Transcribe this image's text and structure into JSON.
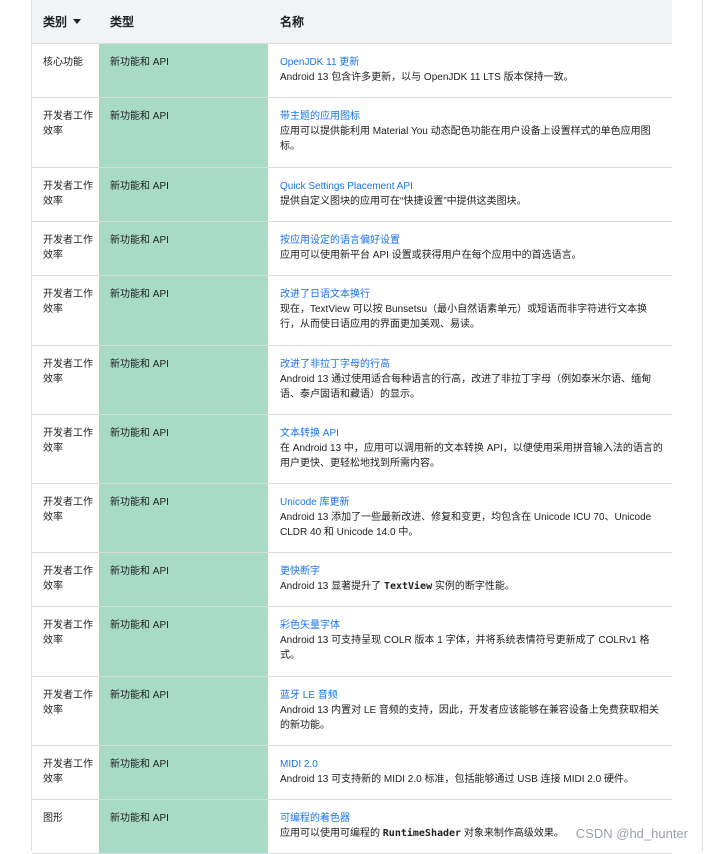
{
  "table": {
    "headers": {
      "category": "类别",
      "type": "类型",
      "name": "名称"
    },
    "rows": [
      {
        "category": "核心功能",
        "type": "新功能和 API",
        "title": "OpenJDK 11 更新",
        "desc": "Android 13 包含许多更新，以与 OpenJDK 11 LTS 版本保持一致。"
      },
      {
        "category": "开发者工作效率",
        "type": "新功能和 API",
        "title": "带主题的应用图标",
        "desc": "应用可以提供能利用 Material You 动态配色功能在用户设备上设置样式的单色应用图标。"
      },
      {
        "category": "开发者工作效率",
        "type": "新功能和 API",
        "title": "Quick Settings Placement API",
        "desc": "提供自定义图块的应用可在“快捷设置”中提供这类图块。"
      },
      {
        "category": "开发者工作效率",
        "type": "新功能和 API",
        "title": "按应用设定的语言偏好设置",
        "desc": "应用可以使用新平台 API 设置或获得用户在每个应用中的首选语言。"
      },
      {
        "category": "开发者工作效率",
        "type": "新功能和 API",
        "title": "改进了日语文本换行",
        "desc": "现在，TextView 可以按 Bunsetsu（最小自然语素单元）或短语而非字符进行文本换行，从而使日语应用的界面更加美观、易读。"
      },
      {
        "category": "开发者工作效率",
        "type": "新功能和 API",
        "title": "改进了非拉丁字母的行高",
        "desc": "Android 13 通过使用适合每种语言的行高，改进了非拉丁字母（例如泰米尔语、缅甸语、泰卢固语和藏语）的显示。"
      },
      {
        "category": "开发者工作效率",
        "type": "新功能和 API",
        "title": "文本转换 API",
        "desc": "在 Android 13 中，应用可以调用新的文本转换 API，以便使用采用拼音输入法的语言的用户更快、更轻松地找到所需内容。"
      },
      {
        "category": "开发者工作效率",
        "type": "新功能和 API",
        "title": "Unicode 库更新",
        "desc": "Android 13 添加了一些最新改进、修复和变更，均包含在 Unicode ICU 70、Unicode CLDR 40 和 Unicode 14.0 中。"
      },
      {
        "category": "开发者工作效率",
        "type": "新功能和 API",
        "title": "更快断字",
        "desc_pre": "Android 13 显著提升了 ",
        "desc_code": "TextView",
        "desc_post": " 实例的断字性能。"
      },
      {
        "category": "开发者工作效率",
        "type": "新功能和 API",
        "title": "彩色矢量字体",
        "desc": "Android 13 可支持呈现 COLR 版本 1 字体，并将系统表情符号更新成了 COLRv1 格式。"
      },
      {
        "category": "开发者工作效率",
        "type": "新功能和 API",
        "title": "蓝牙 LE 音频",
        "desc": "Android 13 内置对 LE 音频的支持，因此，开发者应该能够在兼容设备上免费获取相关的新功能。"
      },
      {
        "category": "开发者工作效率",
        "type": "新功能和 API",
        "title": "MIDI 2.0",
        "desc": "Android 13 可支持新的 MIDI 2.0 标准，包括能够通过 USB 连接 MIDI 2.0 硬件。"
      },
      {
        "category": "图形",
        "type": "新功能和 API",
        "title": "可编程的着色器",
        "desc_pre": "应用可以使用可编程的 ",
        "desc_code": "RuntimeShader",
        "desc_post": " 对象来制作高级效果。"
      }
    ]
  },
  "watermark": "CSDN @hd_hunter",
  "colors": {
    "type_column_bg": "#a8dbc6",
    "link": "#1a73e8",
    "header_bg": "#f1f3f4"
  }
}
